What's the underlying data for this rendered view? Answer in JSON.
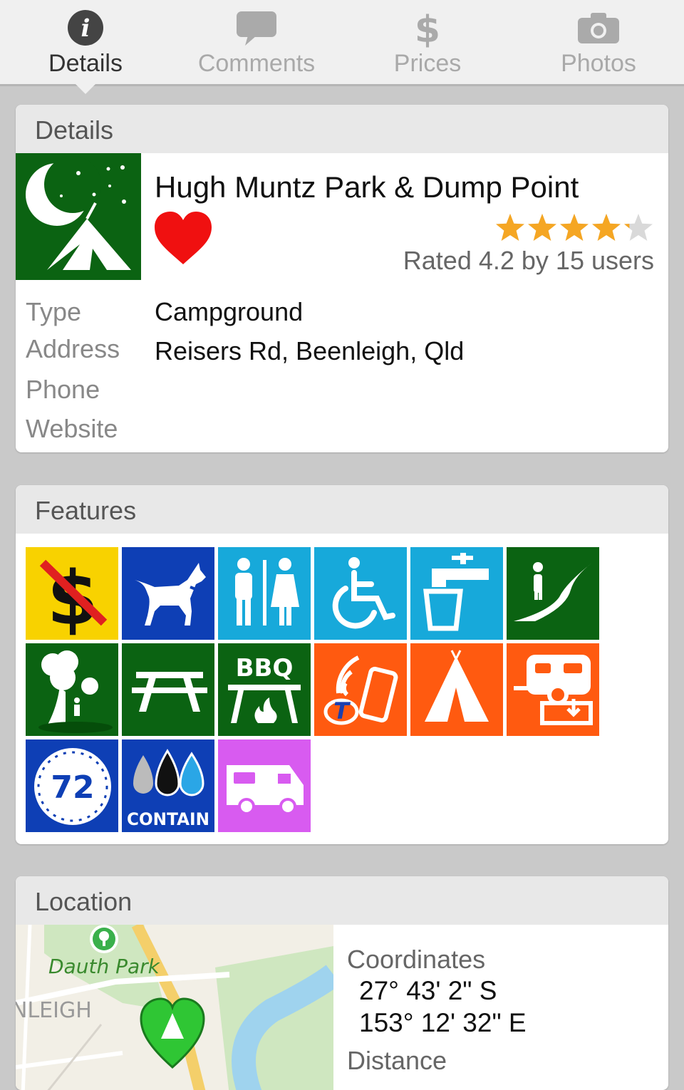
{
  "tabs": [
    {
      "label": "Details",
      "icon": "info-icon",
      "active": true
    },
    {
      "label": "Comments",
      "icon": "speech-bubble-icon",
      "active": false
    },
    {
      "label": "Prices",
      "icon": "dollar-icon",
      "active": false
    },
    {
      "label": "Photos",
      "icon": "camera-icon",
      "active": false
    }
  ],
  "details": {
    "header": "Details",
    "name": "Hugh Muntz Park & Dump Point",
    "site_icon": "campground-night-icon",
    "favourite_icon": "heart-icon",
    "rating": 4.2,
    "rating_max": 5,
    "rating_text": "Rated 4.2 by 15 users",
    "fields": {
      "type_label": "Type",
      "type_value": "Campground",
      "address_label": "Address",
      "address_value": "Reisers Rd, Beenleigh, Qld",
      "phone_label": "Phone",
      "phone_value": "",
      "website_label": "Website",
      "website_value": ""
    }
  },
  "features": {
    "header": "Features",
    "items": [
      {
        "icon": "no-fee-icon",
        "color": "#f8d200"
      },
      {
        "icon": "pets-allowed-icon",
        "color": "#0e3fb5"
      },
      {
        "icon": "toilets-icon",
        "color": "#17a9da"
      },
      {
        "icon": "wheelchair-access-icon",
        "color": "#17a9da"
      },
      {
        "icon": "drinking-water-icon",
        "color": "#17a9da"
      },
      {
        "icon": "walking-track-icon",
        "color": "#0b6312"
      },
      {
        "icon": "shade-trees-icon",
        "color": "#0b6312"
      },
      {
        "icon": "picnic-table-icon",
        "color": "#0b6312"
      },
      {
        "icon": "bbq-icon",
        "color": "#0b6312",
        "text": "BBQ"
      },
      {
        "icon": "telstra-mobile-coverage-icon",
        "color": "#ff5a10"
      },
      {
        "icon": "tent-sites-icon",
        "color": "#ff5a10"
      },
      {
        "icon": "caravan-dump-point-icon",
        "color": "#ff5a10"
      },
      {
        "icon": "max-stay-72-hours-icon",
        "color": "#0e3fb5",
        "text": "72"
      },
      {
        "icon": "self-contained-only-icon",
        "color": "#0e3fb5",
        "text": "CONTAIN"
      },
      {
        "icon": "motorhome-icon",
        "color": "#d85bf0"
      }
    ]
  },
  "location": {
    "header": "Location",
    "map": {
      "park_label": "Dauth Park",
      "suburb_label": "NLEIGH",
      "marker_icon": "map-pin-heart-icon"
    },
    "coordinates_label": "Coordinates",
    "latitude": "27° 43' 2\" S",
    "longitude": "153° 12' 32\" E",
    "distance_label": "Distance"
  }
}
